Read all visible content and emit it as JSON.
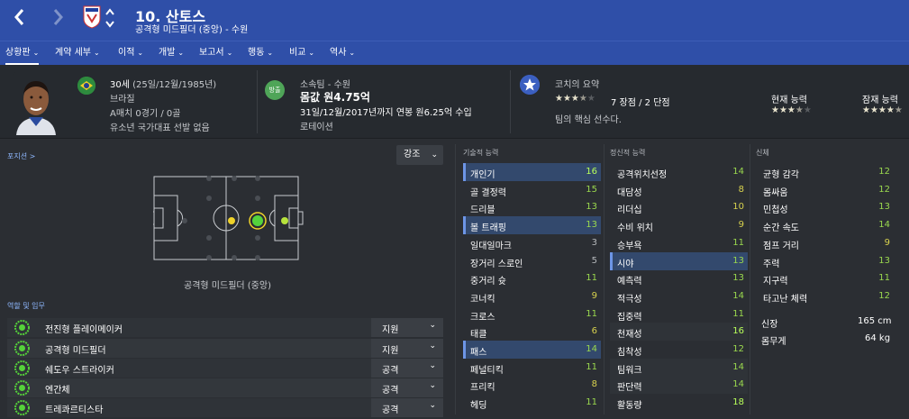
{
  "header": {
    "player_title": "10. 산토스",
    "player_subtitle": "공격형 미드필더 (중앙) - 수원",
    "back_icon": "chevron-left-icon",
    "forward_icon": "chevron-right-icon",
    "colors": {
      "header_bg": "#2f4fa8"
    }
  },
  "tabs": [
    {
      "label": "상황판",
      "active": true
    },
    {
      "label": "계약 세부"
    },
    {
      "label": "이적"
    },
    {
      "label": "개발"
    },
    {
      "label": "보고서"
    },
    {
      "label": "행동"
    },
    {
      "label": "비교"
    },
    {
      "label": "역사"
    }
  ],
  "profile": {
    "age": "30세",
    "birth": "(25일/12월/1985년)",
    "nationality": "브라질",
    "caps": "A매치 0경기 / 0골",
    "youth": "유소년 국가대표 선발 없음",
    "club_badge": "방출",
    "club": "소속팀 - 수원",
    "value": "몸값 원4.75억",
    "contract": "31일/12월/2017년까지 연봉 원6.25억 수입",
    "rotation": "로테이션"
  },
  "coach": {
    "title": "코치의 요약",
    "stars_rating": 3.5,
    "strengths": "7 장점 / 2 단점",
    "summary": "팀의 핵심 선수다.",
    "current_label": "현재 능력",
    "current_stars": 3.5,
    "potential_label": "잠재 능력",
    "potential_stars": 4.5
  },
  "position": {
    "section_label": "포지션 >",
    "dropdown": "강조",
    "caption": "공격형 미드필더 (중앙)"
  },
  "roles": {
    "section_label": "역할 및 임무",
    "items": [
      {
        "name": "전진형 플레이메이커",
        "duty": "지원"
      },
      {
        "name": "공격형 미드필더",
        "duty": "지원"
      },
      {
        "name": "쉐도우 스트라이커",
        "duty": "공격"
      },
      {
        "name": "엔간체",
        "duty": "공격"
      },
      {
        "name": "트레콰르티스타",
        "duty": "공격"
      }
    ]
  },
  "technical": {
    "title": "기술적 능력",
    "items": [
      {
        "name": "개인기",
        "value": "16",
        "hl": true
      },
      {
        "name": "골 결정력",
        "value": "15"
      },
      {
        "name": "드리블",
        "value": "13"
      },
      {
        "name": "볼 트래핑",
        "value": "13",
        "hl": true
      },
      {
        "name": "일대일마크",
        "value": "3"
      },
      {
        "name": "장거리 스로인",
        "value": "5"
      },
      {
        "name": "중거리 슛",
        "value": "11"
      },
      {
        "name": "코너킥",
        "value": "9"
      },
      {
        "name": "크로스",
        "value": "11"
      },
      {
        "name": "태클",
        "value": "6"
      },
      {
        "name": "패스",
        "value": "14",
        "hl": true
      },
      {
        "name": "페널티킥",
        "value": "11"
      },
      {
        "name": "프리킥",
        "value": "8"
      },
      {
        "name": "헤딩",
        "value": "11"
      }
    ]
  },
  "mental": {
    "title": "정신적 능력",
    "items": [
      {
        "name": "공격위치선정",
        "value": "14"
      },
      {
        "name": "대담성",
        "value": "8"
      },
      {
        "name": "리더십",
        "value": "10"
      },
      {
        "name": "수비 위치",
        "value": "9"
      },
      {
        "name": "승부욕",
        "value": "11"
      },
      {
        "name": "시야",
        "value": "13",
        "hl": true
      },
      {
        "name": "예측력",
        "value": "13"
      },
      {
        "name": "적극성",
        "value": "14"
      },
      {
        "name": "집중력",
        "value": "11"
      },
      {
        "name": "천재성",
        "value": "16",
        "hl2": true
      },
      {
        "name": "침착성",
        "value": "12"
      },
      {
        "name": "팀워크",
        "value": "14",
        "hl2": true
      },
      {
        "name": "판단력",
        "value": "14",
        "hl2": true
      },
      {
        "name": "활동량",
        "value": "18"
      }
    ]
  },
  "physical": {
    "title": "신체",
    "items": [
      {
        "name": "균형 감각",
        "value": "12"
      },
      {
        "name": "몸싸움",
        "value": "12"
      },
      {
        "name": "민첩성",
        "value": "13"
      },
      {
        "name": "순간 속도",
        "value": "14"
      },
      {
        "name": "점프 거리",
        "value": "9"
      },
      {
        "name": "주력",
        "value": "13"
      },
      {
        "name": "지구력",
        "value": "11"
      },
      {
        "name": "타고난 체력",
        "value": "12"
      }
    ],
    "height_label": "신장",
    "height": "165 cm",
    "weight_label": "몸무게",
    "weight": "64 kg"
  }
}
